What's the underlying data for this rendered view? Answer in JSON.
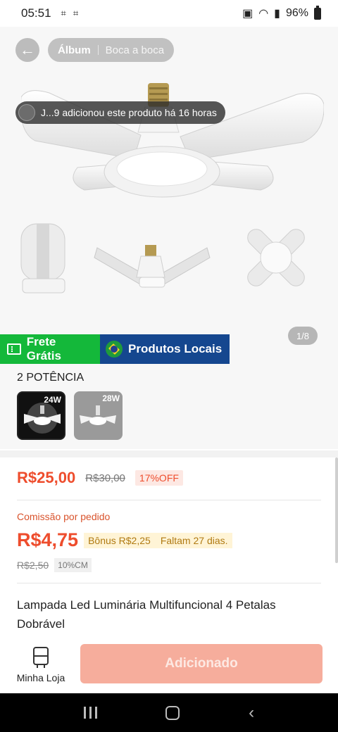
{
  "status_bar": {
    "time": "05:51",
    "battery": "96%"
  },
  "gallery": {
    "tabs": [
      "Álbum",
      "Boca a boca"
    ],
    "notice": "J...9 adicionou este produto há 16 horas",
    "page_counter": "1/8"
  },
  "badges": {
    "free_shipping": "Frete Grátis",
    "local_products": "Produtos Locais"
  },
  "variants": {
    "title": "2 POTÊNCIA",
    "options": [
      {
        "label": "24W",
        "selected": true
      },
      {
        "label": "28W",
        "selected": false
      }
    ]
  },
  "pricing": {
    "price": "R$25,00",
    "old_price": "R$30,00",
    "discount": "17%OFF",
    "commission_label": "Comissão por pedido",
    "commission_value": "R$4,75",
    "bonus": "Bônus R$2,25",
    "days_left": "Faltam 27 dias.",
    "commission_old": "R$2,50",
    "commission_rate": "10%CM"
  },
  "product": {
    "title": "Lampada Led Luminária Multifuncional 4 Petalas Dobrável"
  },
  "action_bar": {
    "store_label": "Minha Loja",
    "add_label": "Adicionado"
  },
  "colors": {
    "accent": "#ee4d2d",
    "free_shipping_bg": "#14b83a",
    "local_bg": "#15478f",
    "add_button_bg": "#f6ad9c"
  }
}
